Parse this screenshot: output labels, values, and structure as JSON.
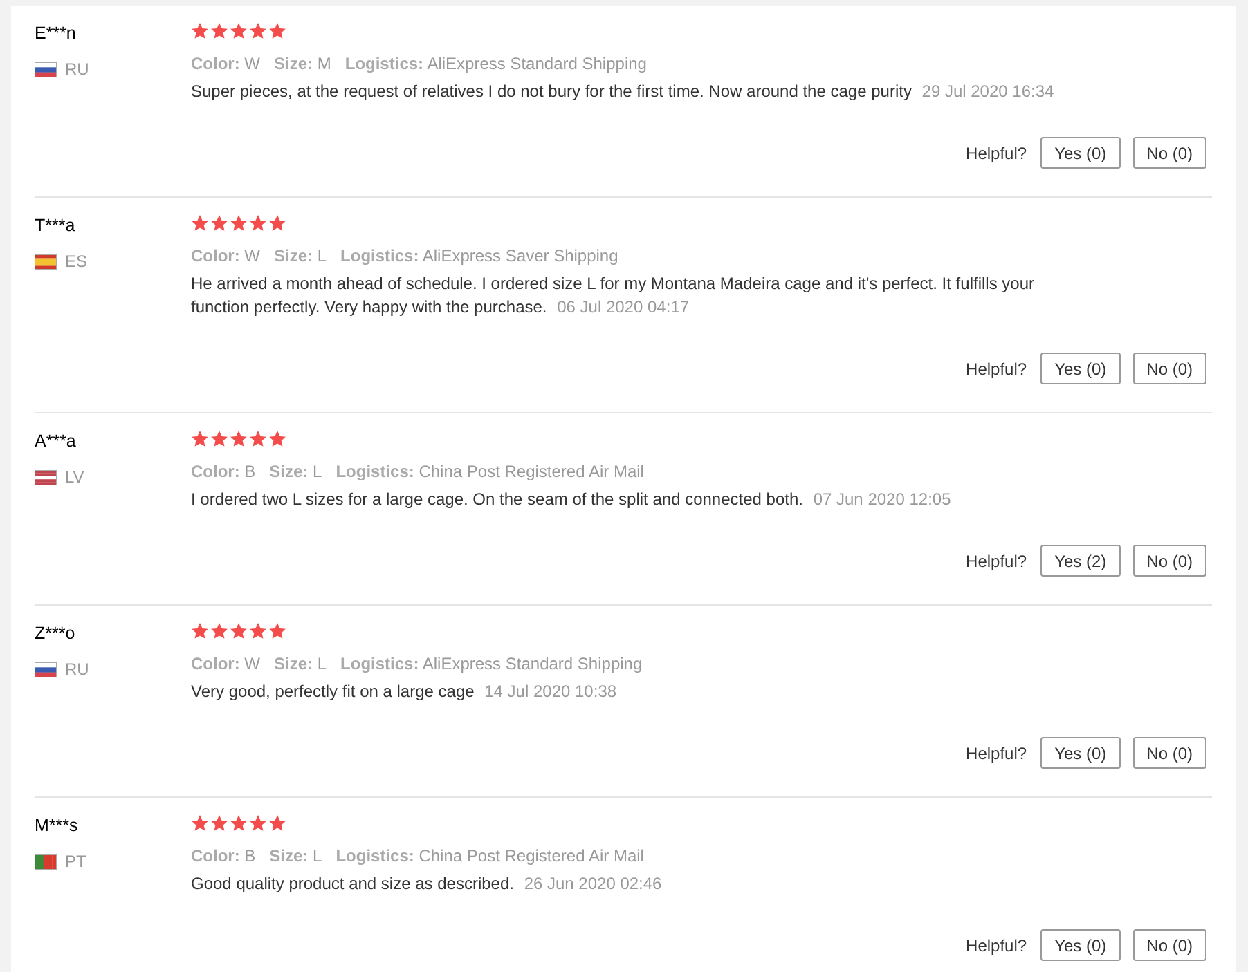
{
  "reviews": [
    {
      "user": "E***n",
      "country": "RU",
      "stars": 5,
      "sku_color": "W",
      "size": "M",
      "logistics": "AliExpress Standard Shipping",
      "color_label": "Color:",
      "size_label": "Size:",
      "logistics_label": "Logistics:",
      "text": "Super pieces, at the request of relatives I do not bury for the first time. Now around the cage purity",
      "date": "29 Jul 2020 16:34",
      "helpful": "Helpful?",
      "yes": "Yes (0)",
      "no": "No (0)"
    },
    {
      "user": "T***a",
      "country": "ES",
      "stars": 5,
      "sku_color": "W",
      "size": "L",
      "logistics": "AliExpress Saver Shipping",
      "color_label": "Color:",
      "size_label": "Size:",
      "logistics_label": "Logistics:",
      "text": "He arrived a month ahead of schedule. I ordered size L for my Montana Madeira cage and it's perfect. It fulfills your function perfectly. Very happy with the purchase.",
      "date": "06 Jul 2020 04:17",
      "helpful": "Helpful?",
      "yes": "Yes (0)",
      "no": "No (0)"
    },
    {
      "user": "A***a",
      "country": "LV",
      "stars": 5,
      "sku_color": "B",
      "size": "L",
      "logistics": "China Post Registered Air Mail",
      "color_label": "Color:",
      "size_label": "Size:",
      "logistics_label": "Logistics:",
      "text": "I ordered two L sizes for a large cage. On the seam of the split and connected both.",
      "date": "07 Jun 2020 12:05",
      "helpful": "Helpful?",
      "yes": "Yes (2)",
      "no": "No (0)"
    },
    {
      "user": "Z***o",
      "country": "RU",
      "stars": 5,
      "sku_color": "W",
      "size": "L",
      "logistics": "AliExpress Standard Shipping",
      "color_label": "Color:",
      "size_label": "Size:",
      "logistics_label": "Logistics:",
      "text": "Very good, perfectly fit on a large cage",
      "date": "14 Jul 2020 10:38",
      "helpful": "Helpful?",
      "yes": "Yes (0)",
      "no": "No (0)"
    },
    {
      "user": "M***s",
      "country": "PT",
      "stars": 5,
      "sku_color": "B",
      "size": "L",
      "logistics": "China Post Registered Air Mail",
      "color_label": "Color:",
      "size_label": "Size:",
      "logistics_label": "Logistics:",
      "text": "Good quality product and size as described.",
      "date": "26 Jun 2020 02:46",
      "helpful": "Helpful?",
      "yes": "Yes (0)",
      "no": "No (0)"
    }
  ]
}
